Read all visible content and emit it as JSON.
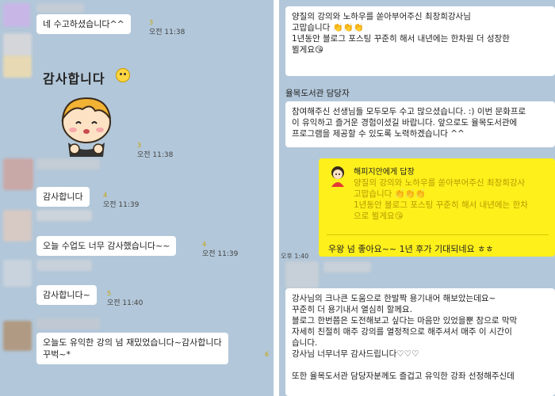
{
  "left": {
    "messages": [
      {
        "text": "네 수고하셨습니다^^",
        "unread": "3",
        "time": "오전 11:38"
      },
      {
        "text": "감사합니다",
        "unread": "4",
        "time": "오전 11:39"
      },
      {
        "text": "오늘 수업도 너무 감사했습니다~~",
        "unread": "4",
        "time": "오전 11:39"
      },
      {
        "text": "감사합니다~",
        "unread": "5",
        "time": "오전 11:40"
      },
      {
        "lines": [
          "오늘도 유익한 강의 넘 재밌었습니다~감사합니다",
          "꾸벅~*"
        ],
        "unread": "6"
      }
    ],
    "sticker": {
      "text": "감사합니다",
      "unread": "3",
      "time": "오전 11:38",
      "icon": "smiley-icon"
    }
  },
  "right": {
    "top_card": {
      "lines": [
        "양질의 강의와 노하우를 쏟아부어주신 최창희강사님",
        "고맙습니다 👏👏👏",
        "1년동안 블로그 포스팅 꾸준히 해서 내년에는 한차원 더 성장한",
        "뵐게요😘"
      ]
    },
    "sender": "율목도서관 담당자",
    "staff_card": {
      "lines": [
        "참여해주신 선생님들 모두모두 수고 많으셨습니다. :) 이번 문화프로",
        "이 유익하고 즐거운 경험이셨길 바랍니다. 앞으로도 율목도서관에",
        "프로그램을 제공할 수 있도록 노력하겠습니다 ^^"
      ]
    },
    "reply": {
      "head": "해피지안에게 답장",
      "quote": [
        "양질의 강의와 노하우를 쏟아부어주신 최창희강사",
        "고맙습니다 👏👏👏",
        "1년동안 블로그 포스팅 꾸준히 해서 내년에는 한차",
        "으로 뵐게요😘"
      ],
      "text": "우왕 넘 좋아요~~ 1년 후가 기대되네요 ㅎㅎ",
      "time": "오후 1:40"
    },
    "bottom_card": {
      "lines": [
        "강사님의 크나큰 도움으로 한발짝 용기내어 해보았는데요~",
        "꾸준히 더 용기내서 열심히 할께요.",
        "블로그 한번쯤은 도전해보고 싶다는 마음만 있었을뿐 참으로 막막",
        "자세히 친절히 매주 강의를 열정적으로 해주셔서 매주 이 시간이",
        "습니다.",
        "강사님 너무너무 감사드립니다♡♡♡",
        "",
        "또한 율목도서관 담당자분께도 즐겁고 유익한 강좌 선정해주신데"
      ]
    }
  }
}
